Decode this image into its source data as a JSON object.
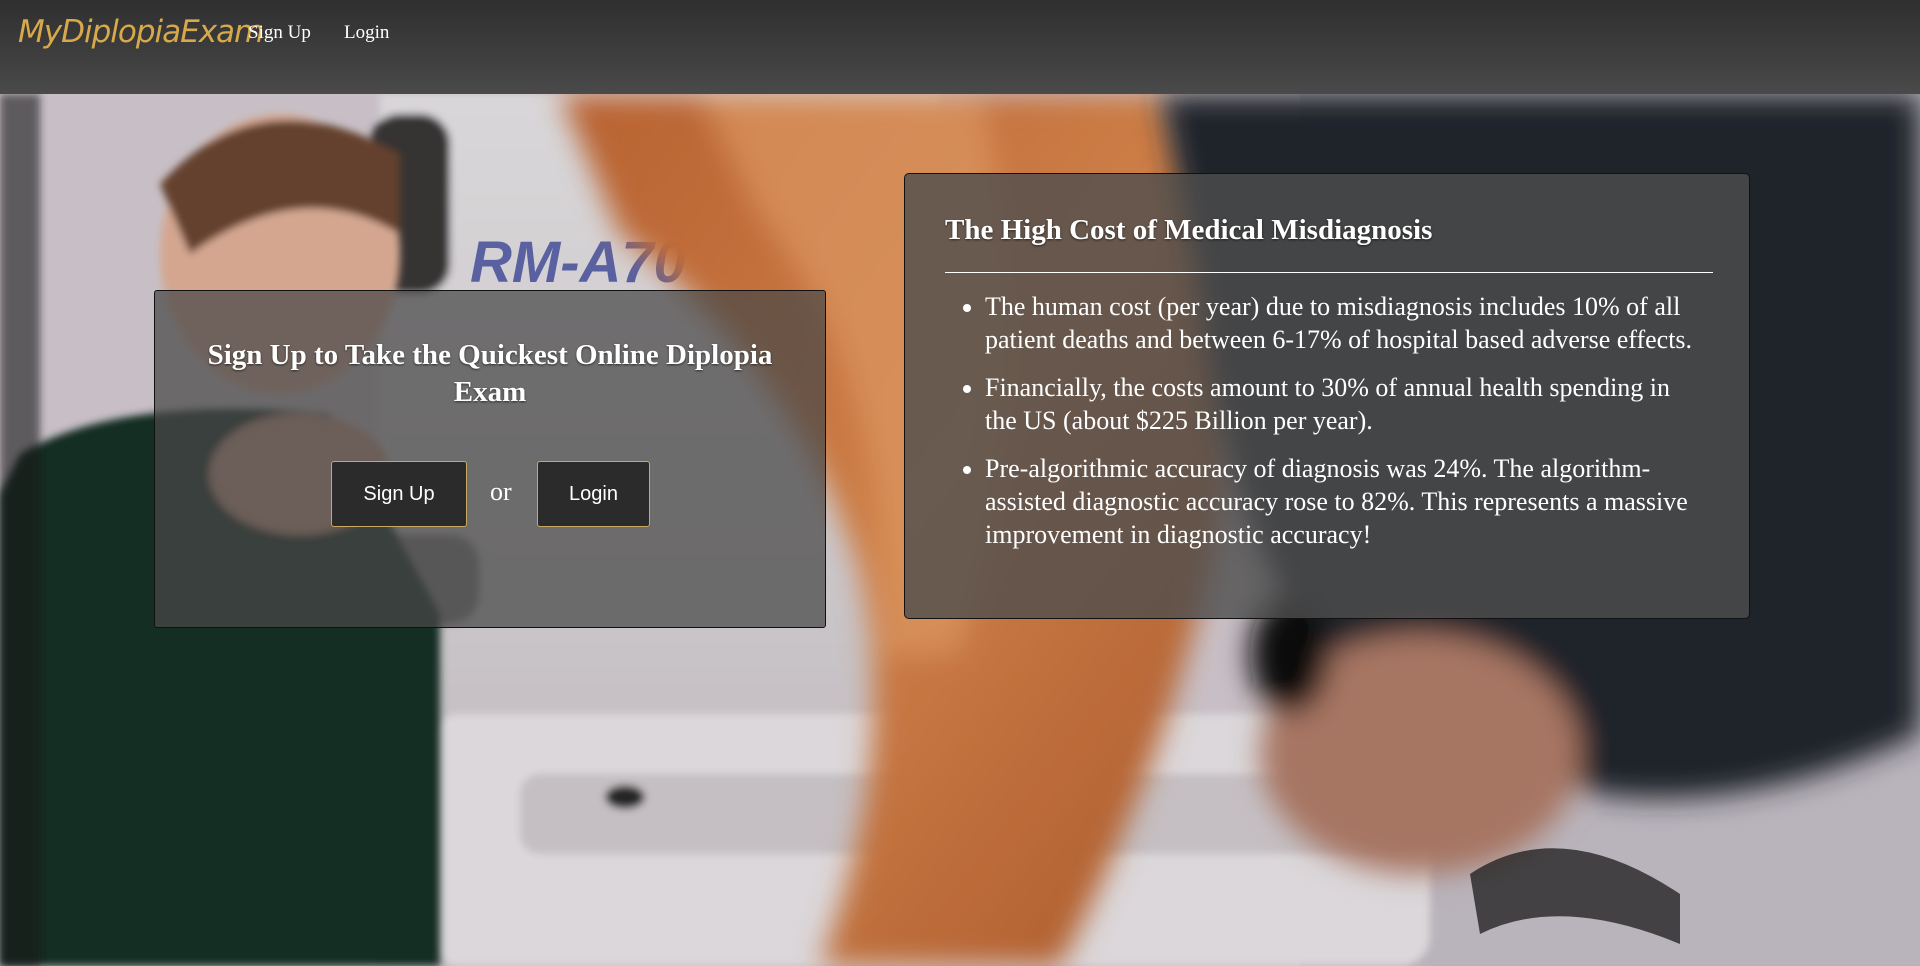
{
  "navbar": {
    "brand": "MyDiplopiaExam",
    "links": [
      {
        "label": "Sign Up"
      },
      {
        "label": "Login"
      }
    ]
  },
  "hero": {
    "background_visible_text": "RM-A70",
    "colors": {
      "navbar": "#3a3a3a",
      "brand": "#d8a94a",
      "button_border": "#c9a95e",
      "button_bg": "#2b2b2b"
    }
  },
  "signup_panel": {
    "title": "Sign Up to Take the Quickest Online Diplopia Exam",
    "signup_button": "Sign Up",
    "or_text": "or",
    "login_button": "Login"
  },
  "info_panel": {
    "title": "The High Cost of Medical Misdiagnosis",
    "items": [
      "The human cost (per year) due to misdiagnosis includes 10% of all patient deaths and between 6-17% of hospital based adverse effects.",
      "Financially, the costs amount to 30% of annual health spending in the US (about $225 Billion per year).",
      "Pre-algorithmic accuracy of diagnosis was 24%. The algorithm-assisted diagnostic accuracy rose to 82%. This represents a massive improvement in diagnostic accuracy!"
    ]
  }
}
